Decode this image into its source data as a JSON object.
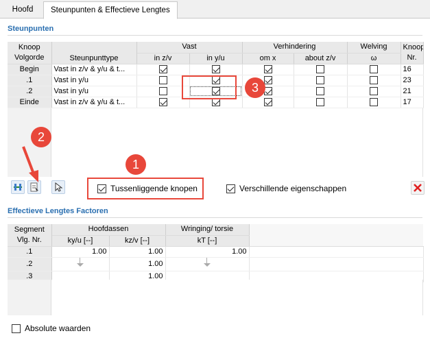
{
  "tabs": [
    {
      "label": "Hoofd",
      "active": false
    },
    {
      "label": "Steunpunten & Effectieve Lengtes",
      "active": true
    }
  ],
  "support": {
    "title": "Steunpunten",
    "headers": {
      "knoop_volgorde_1": "Knoop",
      "knoop_volgorde_2": "Volgorde",
      "steunpunttype": "Steunpunttype",
      "vast": "Vast",
      "vast_zv": "in z/v",
      "vast_yu": "in y/u",
      "verhindering": "Verhindering",
      "om_x": "om x",
      "about_zv": "about z/v",
      "welving": "Welving",
      "omega": "ω",
      "knoop_nr_1": "Knoop",
      "knoop_nr_2": "Nr."
    },
    "rows": [
      {
        "seq": "Begin",
        "type": "Vast in z/v & y/u & t...",
        "zv": true,
        "yu": true,
        "omx": true,
        "aboutzv": false,
        "welving": false,
        "node": "16"
      },
      {
        "seq": ".1",
        "type": "Vast in y/u",
        "zv": false,
        "yu": true,
        "omx": true,
        "aboutzv": false,
        "welving": false,
        "node": "23"
      },
      {
        "seq": ".2",
        "type": "Vast in y/u",
        "zv": false,
        "yu": true,
        "omx": true,
        "aboutzv": false,
        "welving": false,
        "node": "21"
      },
      {
        "seq": "Einde",
        "type": "Vast in z/v & y/u & t...",
        "zv": true,
        "yu": true,
        "omx": true,
        "aboutzv": false,
        "welving": false,
        "node": "17"
      }
    ],
    "tussenliggende_label": "Tussenliggende knopen",
    "tussenliggende_checked": true,
    "verschillende_label": "Verschillende eigenschappen",
    "verschillende_checked": true,
    "toolbar_icons": [
      "insert-node-icon",
      "select-table-icon",
      "pick-pointer-icon"
    ],
    "delete_icon": "delete-x-icon"
  },
  "effective": {
    "title": "Effectieve Lengtes Factoren",
    "headers": {
      "segment_1": "Segment",
      "segment_2": "Vlg. Nr.",
      "hoofdassen": "Hoofdassen",
      "ky": "ky/u [--]",
      "kz": "kz/v [--]",
      "wringing": "Wringing/ torsie",
      "kt": "kT [--]"
    },
    "rows": [
      {
        "seg": ".1",
        "ky": "1.00",
        "kz": "1.00",
        "kt": "1.00"
      },
      {
        "seg": ".2",
        "ky": "",
        "kz": "1.00",
        "kt": ""
      },
      {
        "seg": ".3",
        "ky": "",
        "kz": "1.00",
        "kt": ""
      }
    ],
    "absolute_label": "Absolute waarden",
    "absolute_checked": false
  },
  "callouts": [
    "1",
    "2",
    "3"
  ],
  "colors": {
    "accent": "#2a6fb0",
    "callout": "#e8473a",
    "delete": "#e02020"
  }
}
